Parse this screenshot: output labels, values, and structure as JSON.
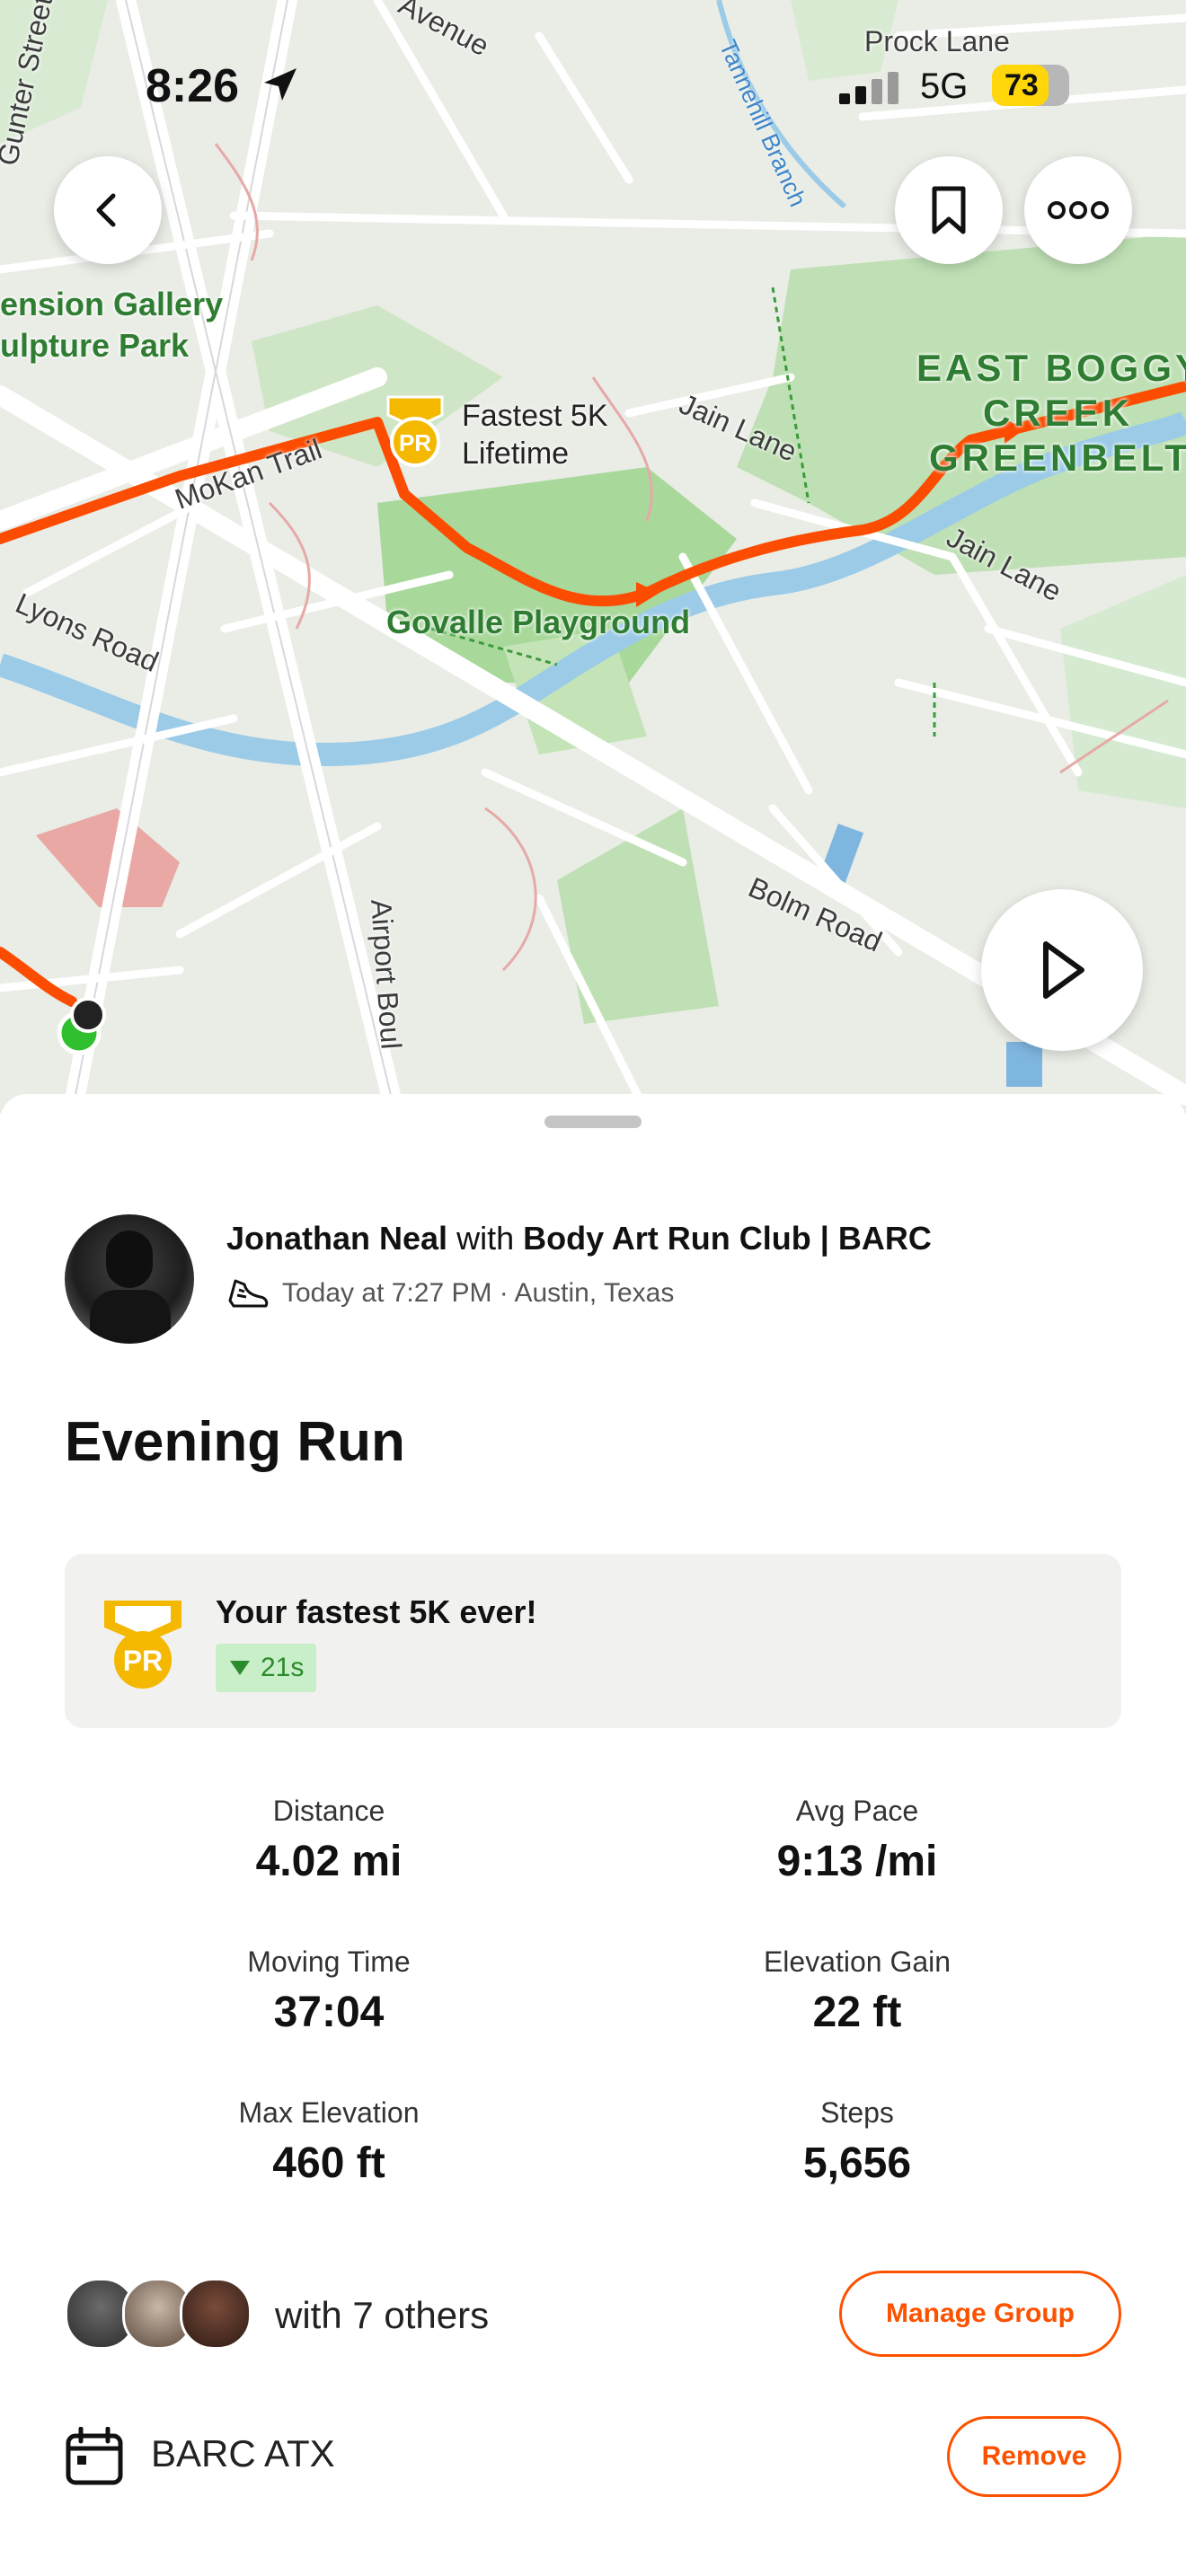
{
  "status_bar": {
    "time": "8:26",
    "network": "5G",
    "battery": "73"
  },
  "map": {
    "streets": [
      "Gunter Street",
      "Avenue",
      "Prock Lane",
      "Tannehill Branch",
      "MoKan Trail",
      "Jain Lane",
      "Jain Lane",
      "Lyons Road",
      "Airport Boul",
      "Bolm Road"
    ],
    "parks": [
      "ension Gallery",
      "ulpture Park",
      "Govalle Playground",
      "EAST BOGGY",
      "CREEK",
      "GREENBELT"
    ],
    "pr_marker": {
      "label_line1": "Fastest 5K",
      "label_line2": "Lifetime",
      "badge": "PR"
    }
  },
  "activity": {
    "athlete": "Jonathan  Neal",
    "with_word": "with",
    "club": "Body Art Run Club | BARC",
    "meta": "Today at 7:27 PM · Austin, Texas",
    "title": "Evening Run"
  },
  "pr_card": {
    "text": "Your fastest 5K ever!",
    "delta": "21s",
    "badge": "PR"
  },
  "stats": [
    {
      "label": "Distance",
      "value": "4.02 mi"
    },
    {
      "label": "Avg Pace",
      "value": "9:13 /mi"
    },
    {
      "label": "Moving Time",
      "value": "37:04"
    },
    {
      "label": "Elevation Gain",
      "value": "22 ft"
    },
    {
      "label": "Max Elevation",
      "value": "460 ft"
    },
    {
      "label": "Steps",
      "value": "5,656"
    }
  ],
  "group": {
    "text": "with 7 others",
    "button": "Manage Group"
  },
  "club_row": {
    "name": "BARC ATX",
    "button": "Remove"
  },
  "colors": {
    "accent": "#fc5200",
    "pr_gold": "#f5b800",
    "park": "#2f7d32"
  }
}
